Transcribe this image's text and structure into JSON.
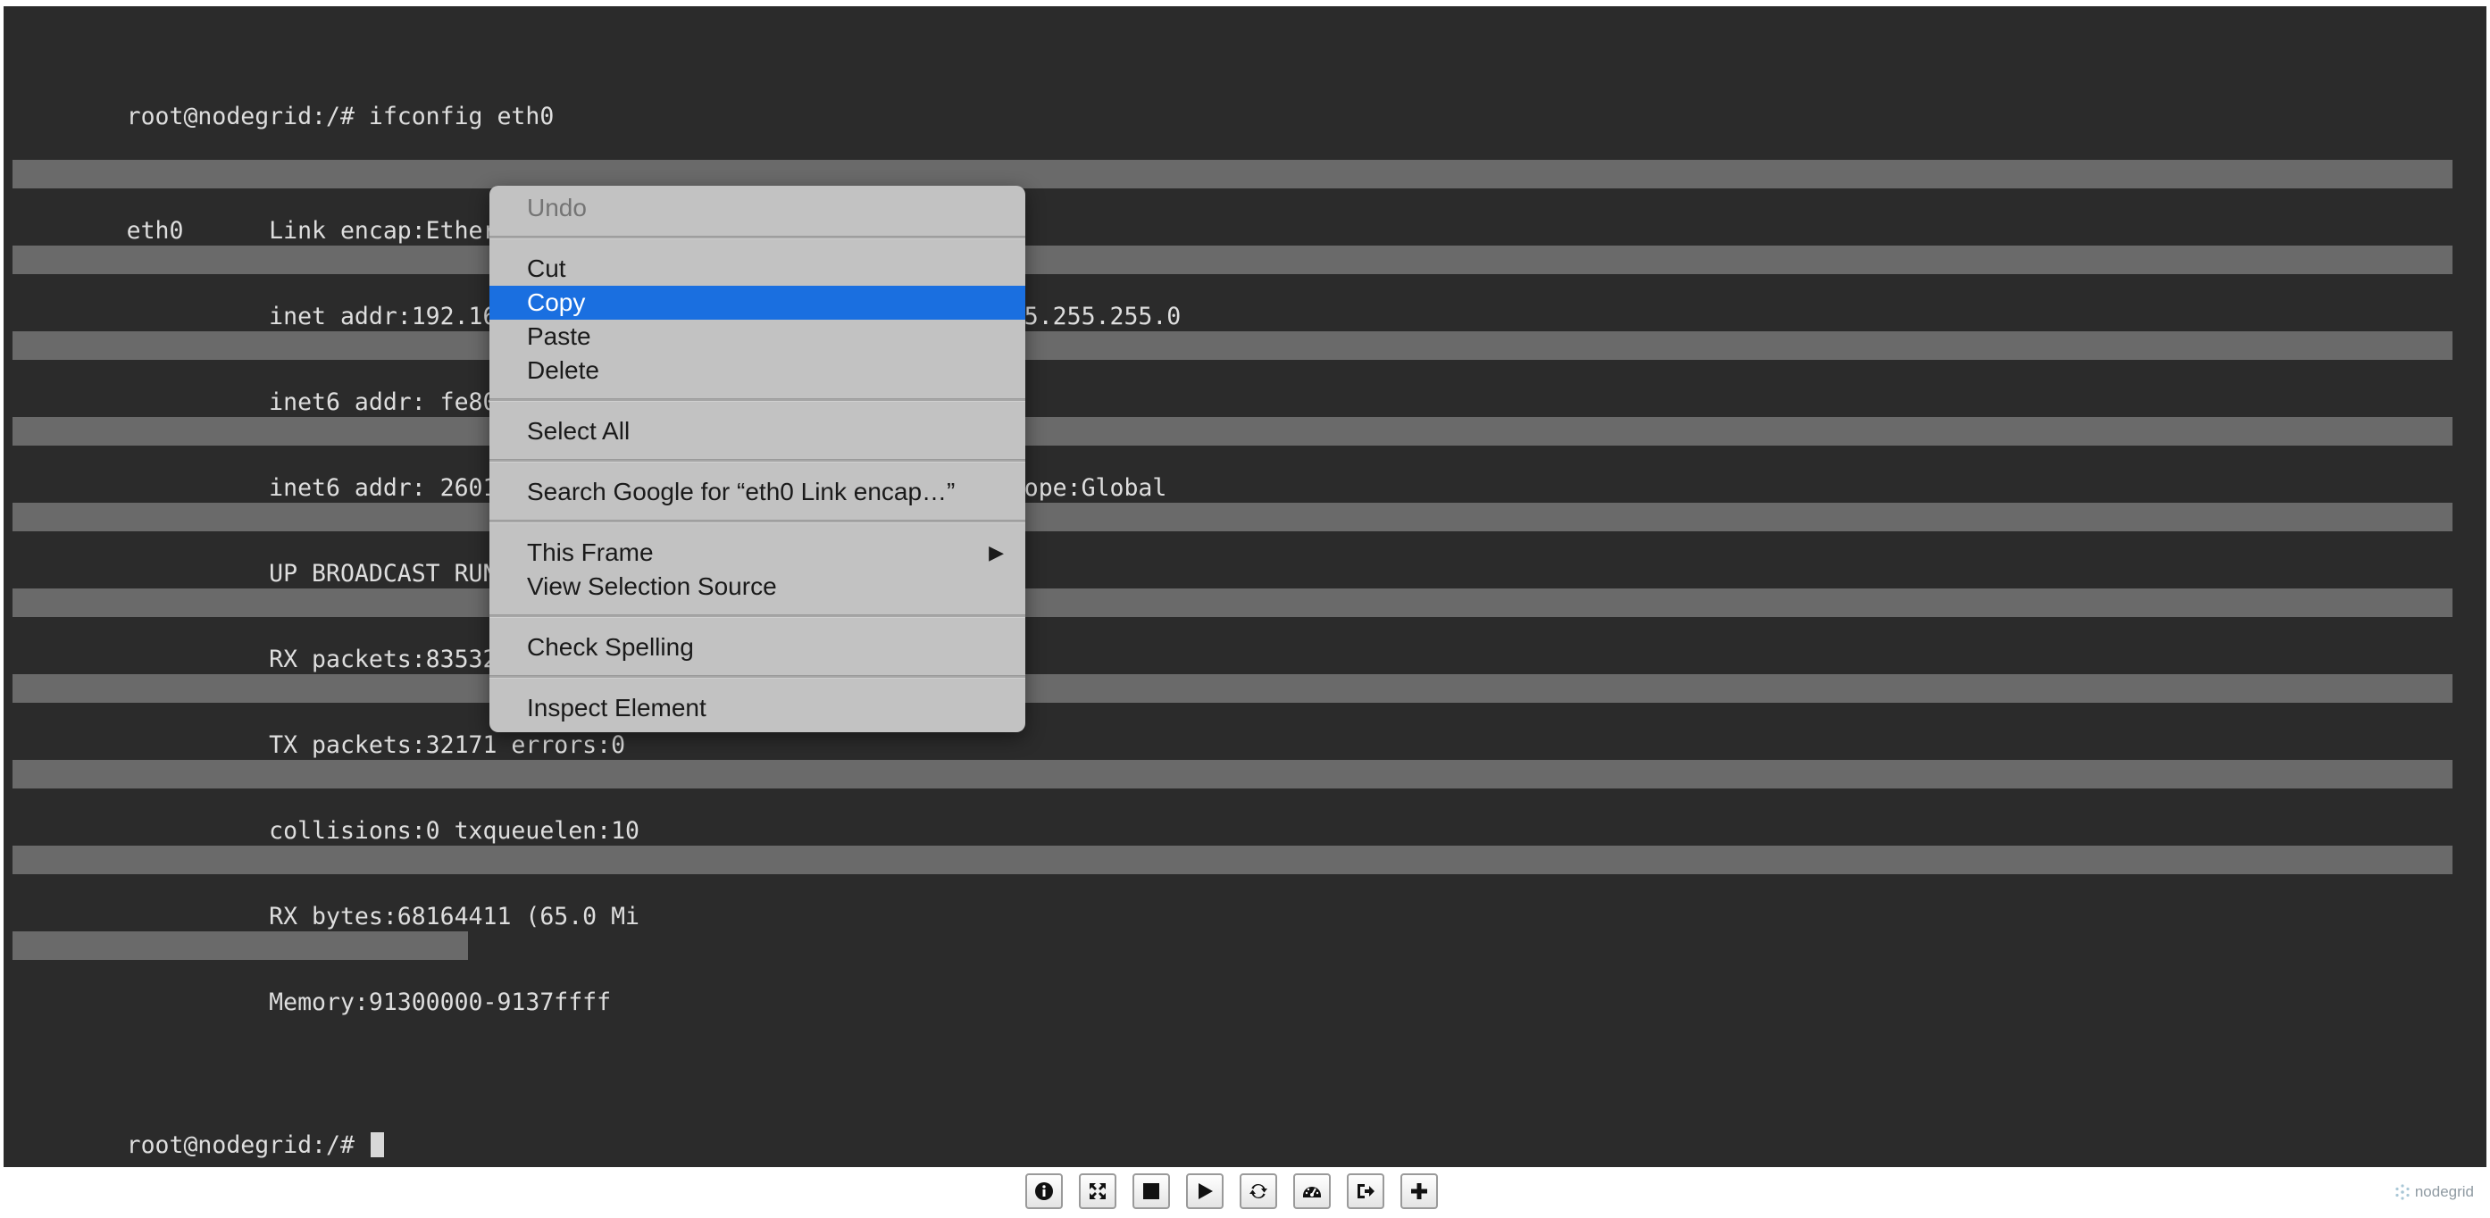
{
  "terminal": {
    "lines": [
      "root@nodegrid:/# ifconfig eth0",
      "eth0      Link encap:Ethernet  HWaddr 00:90:fb:4e:09:ac",
      "          inet addr:192.168.2.152  Bcast:192.168.2.255  Mask:255.255.255.0",
      "          inet6 addr: fe80::290:fbff:fe4e:9ac/64 Scope:Link",
      "          inet6 addr: 2601:641:100:c400:290:fbff:fe4e:9ac/64 Scope:Global",
      "          UP BROADCAST RUNNING MULTICAST  MTU:1500  Metric:1",
      "          RX packets:835326 errors:0",
      "          TX packets:32171 errors:0",
      "          collisions:0 txqueuelen:10",
      "          RX bytes:68164411 (65.0 Mi",
      "          Memory:91300000-9137ffff",
      "",
      "root@nodegrid:/# "
    ]
  },
  "context_menu": {
    "undo": "Undo",
    "cut": "Cut",
    "copy": "Copy",
    "paste": "Paste",
    "delete": "Delete",
    "select_all": "Select All",
    "search_google": "Search Google for “eth0 Link encap…”",
    "this_frame": "This Frame",
    "view_selection_source": "View Selection Source",
    "check_spelling": "Check Spelling",
    "inspect_element": "Inspect Element",
    "highlight_color": "#1a6fe0"
  },
  "toolbar": {
    "icons": [
      "info-icon",
      "fullscreen-icon",
      "stop-icon",
      "play-icon",
      "refresh-icon",
      "dashboard-icon",
      "logout-icon",
      "plus-icon"
    ],
    "brand": "nodegrid"
  }
}
